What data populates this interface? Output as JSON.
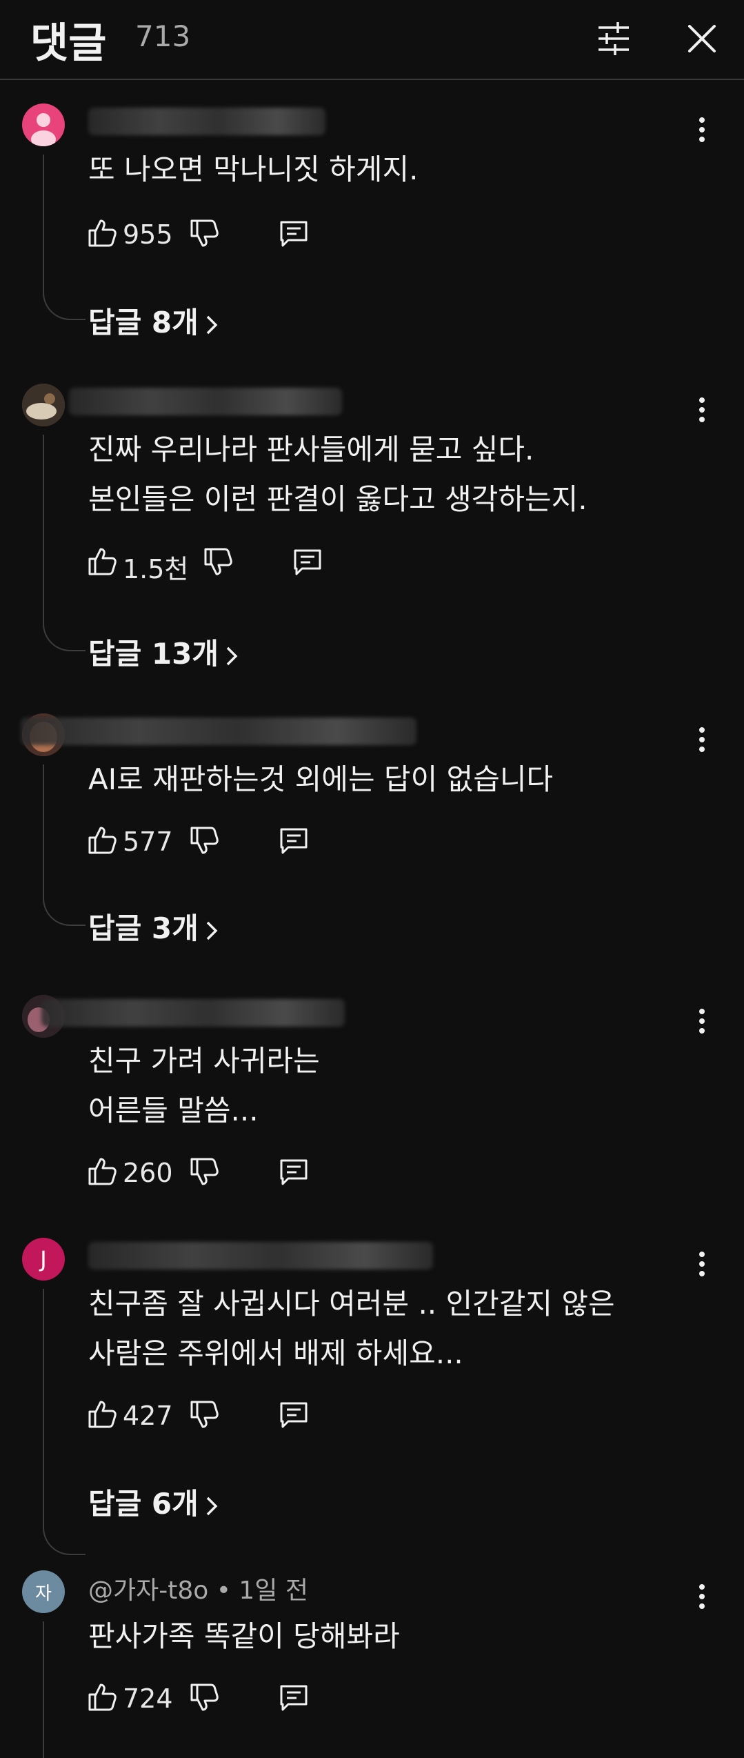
{
  "header": {
    "title": "댓글",
    "count": "713"
  },
  "comments": [
    {
      "author": "",
      "text": [
        "또 나오면 막나니짓 하게지."
      ],
      "likes": "955",
      "replies": "답글 8개",
      "avatar_color": "#e8437a"
    },
    {
      "author": "",
      "text": [
        "진짜 우리나라 판사들에게 묻고 싶다.",
        "본인들은 이런 판결이 옳다고 생각하는지."
      ],
      "likes": "1.5천",
      "replies": "답글 13개"
    },
    {
      "author": "",
      "text": [
        "AI로  재판하는것  외에는  답이 없습니다"
      ],
      "likes": "577",
      "replies": "답글 3개"
    },
    {
      "author": "",
      "text": [
        "친구 가려 사귀라는",
        "어른들 말씀..."
      ],
      "likes": "260",
      "replies": ""
    },
    {
      "author": "",
      "text": [
        "친구좀 잘 사귑시다 여러분 .. 인간같지 않은",
        "사람은 주위에서 배제 하세요..."
      ],
      "likes": "427",
      "replies": "답글 6개",
      "avatar_letter": "J",
      "avatar_color": "#c2185b"
    },
    {
      "author": "@가자-t8o • 1일 전",
      "text": [
        "판사가족 똑같이 당해봐라"
      ],
      "likes": "724",
      "replies": "",
      "avatar_letter": "자",
      "avatar_color": "#6d8ba0"
    }
  ]
}
